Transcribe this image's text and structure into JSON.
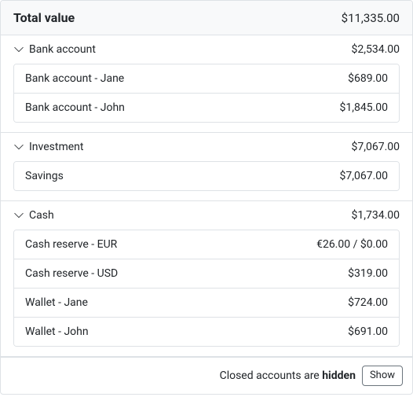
{
  "total": {
    "label": "Total value",
    "amount": "$11,335.00"
  },
  "groups": [
    {
      "title": "Bank account",
      "amount": "$2,534.00",
      "items": [
        {
          "label": "Bank account - Jane",
          "amount": "$689.00"
        },
        {
          "label": "Bank account - John",
          "amount": "$1,845.00"
        }
      ]
    },
    {
      "title": "Investment",
      "amount": "$7,067.00",
      "items": [
        {
          "label": "Savings",
          "amount": "$7,067.00"
        }
      ]
    },
    {
      "title": "Cash",
      "amount": "$1,734.00",
      "items": [
        {
          "label": "Cash reserve - EUR",
          "amount": "€26.00 / $0.00"
        },
        {
          "label": "Cash reserve - USD",
          "amount": "$319.00"
        },
        {
          "label": "Wallet - Jane",
          "amount": "$724.00"
        },
        {
          "label": "Wallet - John",
          "amount": "$691.00"
        }
      ]
    }
  ],
  "footer": {
    "prefix": "Closed accounts are ",
    "state": "hidden",
    "button": "Show"
  }
}
